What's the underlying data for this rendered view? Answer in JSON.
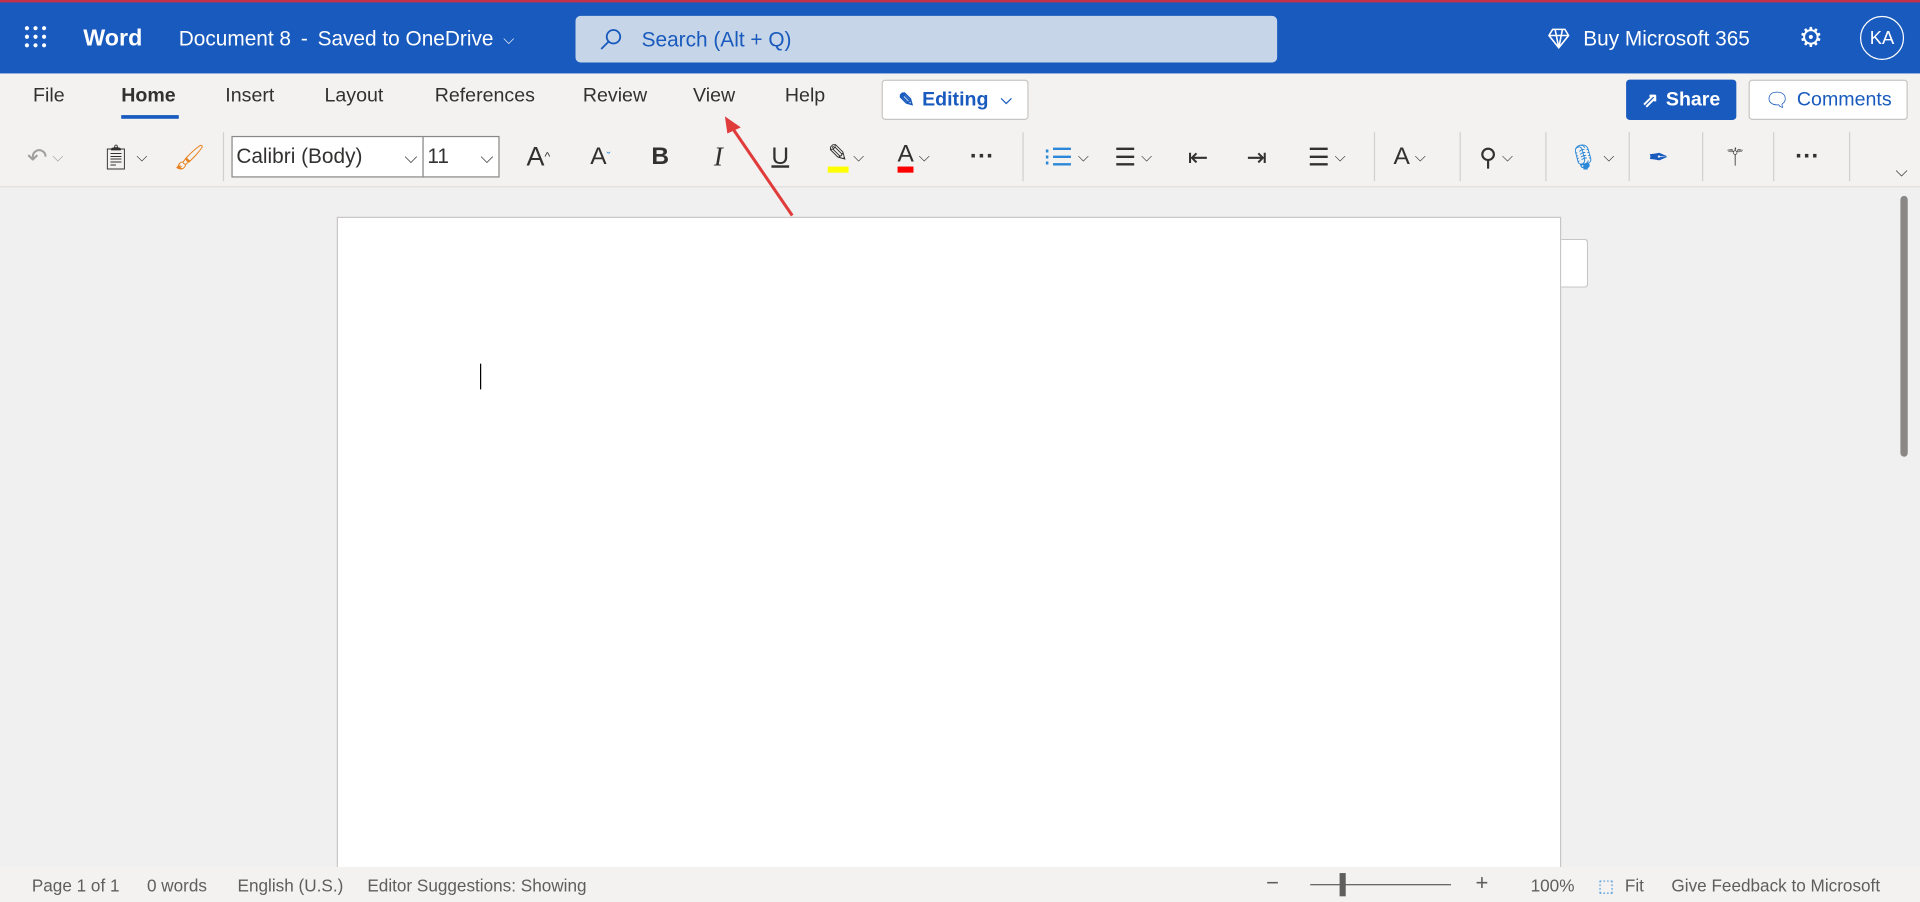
{
  "app": {
    "name": "Word",
    "doc_title": "Document 8",
    "separator": "-",
    "save_status": "Saved to OneDrive"
  },
  "search": {
    "placeholder": "Search (Alt + Q)"
  },
  "header": {
    "buy_label": "Buy Microsoft 365",
    "avatar_initials": "KA"
  },
  "tabs": [
    "File",
    "Home",
    "Insert",
    "Layout",
    "References",
    "Review",
    "View",
    "Help"
  ],
  "active_tab": "Home",
  "mode": {
    "label": "Editing"
  },
  "actions": {
    "share": "Share",
    "comments": "Comments"
  },
  "toolbar": {
    "font_name": "Calibri (Body)",
    "font_size": "11",
    "grow_font": "A",
    "shrink_font": "A",
    "bold": "B",
    "italic": "I",
    "underline": "U",
    "font_color": "A",
    "more": "···"
  },
  "colors": {
    "brand": "#185abd",
    "highlight": "#ffff00",
    "font_color": "#ff0000",
    "annotation_arrow": "#e03c3c"
  },
  "status": {
    "page": "Page 1 of 1",
    "words": "0 words",
    "language": "English (U.S.)",
    "editor": "Editor Suggestions: Showing",
    "zoom": "100%",
    "fit": "Fit",
    "feedback": "Give Feedback to Microsoft",
    "zoom_minus": "−",
    "zoom_plus": "+"
  }
}
